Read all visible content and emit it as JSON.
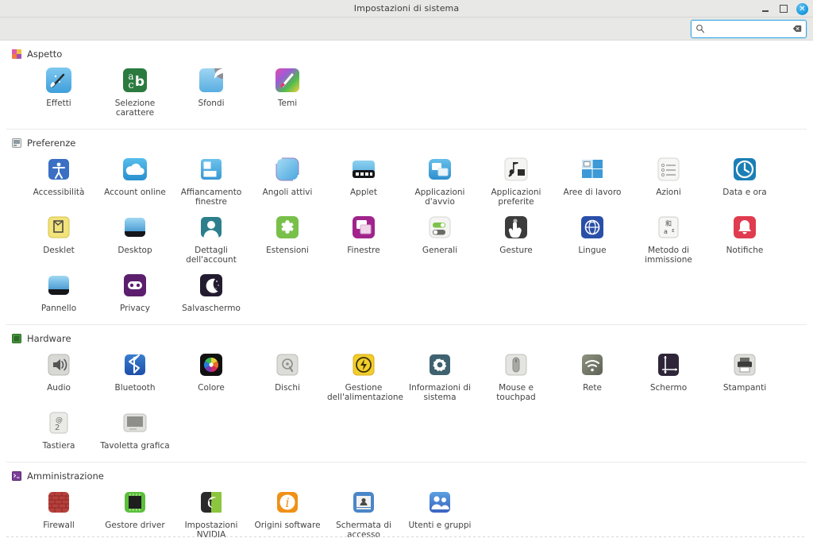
{
  "window": {
    "title": "Impostazioni di sistema",
    "controls": {
      "minimize_label": "–",
      "maximize_label": "□",
      "close_label": "✕"
    }
  },
  "search": {
    "value": "",
    "placeholder": "",
    "search_icon": "search-icon",
    "clear_icon": "clear-icon"
  },
  "sections": [
    {
      "id": "aspetto",
      "title": "Aspetto",
      "icon": "appearance-icon",
      "icon_color": "#d05a9a",
      "items": [
        {
          "label": "Effetti",
          "icon": "effects-icon"
        },
        {
          "label": "Selezione carattere",
          "icon": "font-selection-icon"
        },
        {
          "label": "Sfondi",
          "icon": "backgrounds-icon"
        },
        {
          "label": "Temi",
          "icon": "themes-icon"
        }
      ]
    },
    {
      "id": "preferenze",
      "title": "Preferenze",
      "icon": "preferences-icon",
      "icon_color": "#8f8f8f",
      "items": [
        {
          "label": "Accessibilità",
          "icon": "accessibility-icon"
        },
        {
          "label": "Account online",
          "icon": "online-accounts-icon"
        },
        {
          "label": "Affiancamento\nfinestre",
          "icon": "window-tiling-icon"
        },
        {
          "label": "Angoli attivi",
          "icon": "hot-corners-icon"
        },
        {
          "label": "Applet",
          "icon": "applet-icon"
        },
        {
          "label": "Applicazioni d'avvio",
          "icon": "startup-applications-icon"
        },
        {
          "label": "Applicazioni\npreferite",
          "icon": "preferred-applications-icon"
        },
        {
          "label": "Aree di lavoro",
          "icon": "workspaces-icon"
        },
        {
          "label": "Azioni",
          "icon": "actions-icon"
        },
        {
          "label": "Data e ora",
          "icon": "date-time-icon"
        },
        {
          "label": "Desklet",
          "icon": "desklet-icon"
        },
        {
          "label": "Desktop",
          "icon": "desktop-icon"
        },
        {
          "label": "Dettagli\ndell'account",
          "icon": "account-details-icon"
        },
        {
          "label": "Estensioni",
          "icon": "extensions-icon"
        },
        {
          "label": "Finestre",
          "icon": "windows-icon"
        },
        {
          "label": "Generali",
          "icon": "general-icon"
        },
        {
          "label": "Gesture",
          "icon": "gestures-icon"
        },
        {
          "label": "Lingue",
          "icon": "languages-icon"
        },
        {
          "label": "Metodo di\nimmissione",
          "icon": "input-method-icon"
        },
        {
          "label": "Notifiche",
          "icon": "notifications-icon"
        },
        {
          "label": "Pannello",
          "icon": "panel-icon"
        },
        {
          "label": "Privacy",
          "icon": "privacy-icon"
        },
        {
          "label": "Salvaschermo",
          "icon": "screensaver-icon"
        }
      ]
    },
    {
      "id": "hardware",
      "title": "Hardware",
      "icon": "hardware-icon",
      "icon_color": "#3b8f3b",
      "items": [
        {
          "label": "Audio",
          "icon": "sound-icon"
        },
        {
          "label": "Bluetooth",
          "icon": "bluetooth-icon"
        },
        {
          "label": "Colore",
          "icon": "color-icon"
        },
        {
          "label": "Dischi",
          "icon": "disks-icon"
        },
        {
          "label": "Gestione\ndell'alimentazione",
          "icon": "power-management-icon"
        },
        {
          "label": "Informazioni di\nsistema",
          "icon": "system-info-icon"
        },
        {
          "label": "Mouse e touchpad",
          "icon": "mouse-touchpad-icon"
        },
        {
          "label": "Rete",
          "icon": "network-icon"
        },
        {
          "label": "Schermo",
          "icon": "display-icon"
        },
        {
          "label": "Stampanti",
          "icon": "printers-icon"
        },
        {
          "label": "Tastiera",
          "icon": "keyboard-icon"
        },
        {
          "label": "Tavoletta grafica",
          "icon": "graphics-tablet-icon"
        }
      ]
    },
    {
      "id": "amministrazione",
      "title": "Amministrazione",
      "icon": "administration-icon",
      "icon_color": "#7b3f96",
      "items": [
        {
          "label": "Firewall",
          "icon": "firewall-icon"
        },
        {
          "label": "Gestore driver",
          "icon": "driver-manager-icon"
        },
        {
          "label": "Impostazioni\nNVIDIA",
          "icon": "nvidia-settings-icon"
        },
        {
          "label": "Origini software",
          "icon": "software-sources-icon"
        },
        {
          "label": "Schermata di\naccesso",
          "icon": "login-screen-icon"
        },
        {
          "label": "Utenti e gruppi",
          "icon": "users-groups-icon"
        }
      ]
    }
  ]
}
